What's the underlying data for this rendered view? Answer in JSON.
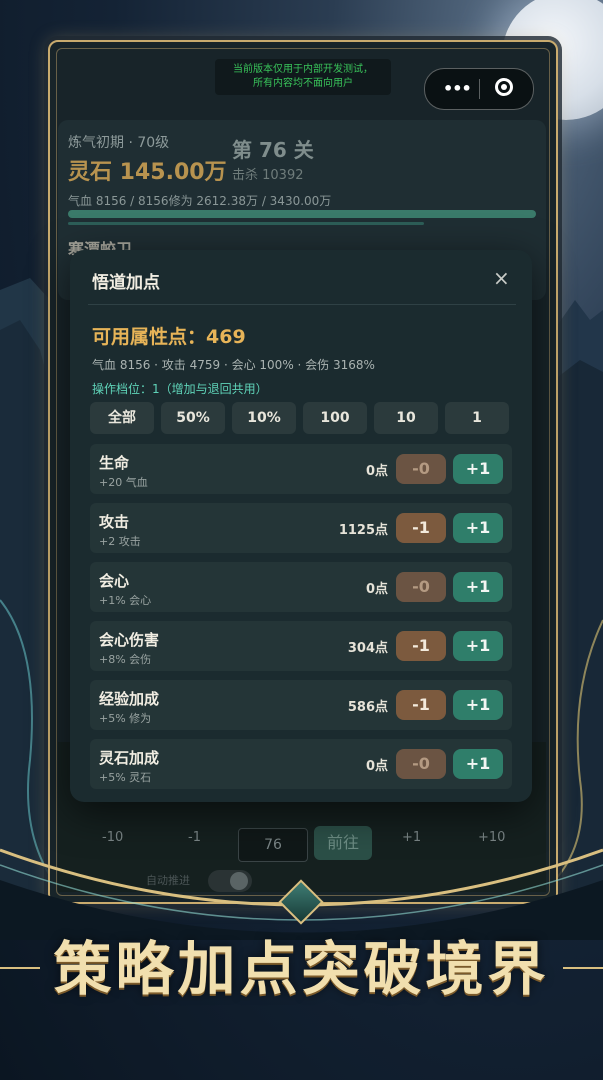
{
  "notice": {
    "line1": "当前版本仅用于内部开发测试，",
    "line2": "所有内容均不面向用户"
  },
  "capsule": {
    "more_icon": "more-dots-icon",
    "close_icon": "target-icon"
  },
  "background_game": {
    "realm": "炼气初期 · 70级",
    "stage": "第 76 关",
    "spirit_stone": "灵石 145.00万",
    "kills": "击杀 10392",
    "stats": "气血 8156 / 8156修为 2612.38万 / 3430.00万",
    "monster": "寒潭蛟卫",
    "controls": {
      "m10": "-10",
      "m1": "-1",
      "level": "76",
      "go": "前往",
      "p1": "+1",
      "p10": "+10",
      "auto_label": "自动推进"
    }
  },
  "modal": {
    "title": "悟道加点",
    "close_label": "×",
    "available": "可用属性点：469",
    "attributes_line": "气血 8156 · 攻击 4759 · 会心 100% · 会伤 3168%",
    "step_line": "操作档位：1（增加与退回共用）",
    "step_buttons": [
      "全部",
      "50%",
      "10%",
      "100",
      "10",
      "1"
    ],
    "rows": [
      {
        "name": "生命",
        "sub": "+20 气血",
        "points": "0点",
        "minus": "-0",
        "plus": "+1"
      },
      {
        "name": "攻击",
        "sub": "+2 攻击",
        "points": "1125点",
        "minus": "-1",
        "plus": "+1"
      },
      {
        "name": "会心",
        "sub": "+1% 会心",
        "points": "0点",
        "minus": "-0",
        "plus": "+1"
      },
      {
        "name": "会心伤害",
        "sub": "+8% 会伤",
        "points": "304点",
        "minus": "-1",
        "plus": "+1"
      },
      {
        "name": "经验加成",
        "sub": "+5% 修为",
        "points": "586点",
        "minus": "-1",
        "plus": "+1"
      },
      {
        "name": "灵石加成",
        "sub": "+5% 灵石",
        "points": "0点",
        "minus": "-0",
        "plus": "+1"
      }
    ]
  },
  "banner": "策略加点突破境界",
  "colors": {
    "accent_gold": "#e7b458",
    "plus_green": "#2f7e6a",
    "minus_brown": "#7c5a3e",
    "frame_gold": "#c9ab6e"
  }
}
